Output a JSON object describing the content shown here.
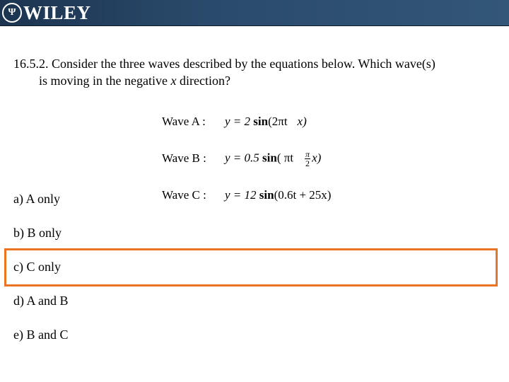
{
  "header": {
    "logo_icon": "wiley-emblem-icon",
    "logo_text": "WILEY",
    "background_color": "#2a4a6b"
  },
  "question": {
    "number": "16.5.2.",
    "line1": "16.5.2. Consider the three waves described by the equations below.  Which wave(s)",
    "line2_pre": "is moving in the negative ",
    "line2_var": "x",
    "line2_post": " direction?"
  },
  "equations": [
    {
      "label": "Wave A :",
      "prefix": "y = 2 ",
      "func": "sin",
      "arg_a": "(2πt",
      "arg_b": "x)",
      "fraction": null
    },
    {
      "label": "Wave B :",
      "prefix": "y = 0.5 ",
      "func": "sin",
      "arg_a": "( πt",
      "arg_b": "x)",
      "fraction": {
        "num": "π",
        "den": "2"
      }
    },
    {
      "label": "Wave C :",
      "prefix": "y = 12 ",
      "func": "sin",
      "arg_a": "(0.6t + 25x)",
      "arg_b": "",
      "fraction": null
    }
  ],
  "options": [
    {
      "label": "a)  A only"
    },
    {
      "label": "b)  B only"
    },
    {
      "label": "c)  C only",
      "highlighted": true
    },
    {
      "label": "d)  A and B"
    },
    {
      "label": "e)  B and C"
    }
  ],
  "highlight_color": "#ec7321"
}
